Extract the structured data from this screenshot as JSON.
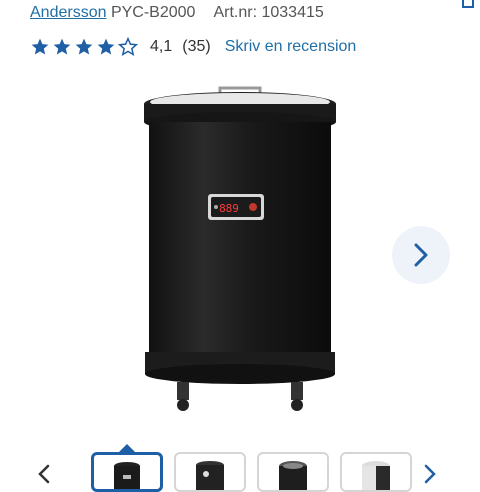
{
  "product": {
    "brand": "Andersson",
    "model": "PYC-B2000",
    "article_label": "Art.nr:",
    "article_number": "1033415"
  },
  "rating": {
    "value": 4.1,
    "display": "4,1",
    "count": "(35)",
    "stars_filled": 4,
    "stars_total": 5,
    "review_link": "Skriv en recension"
  },
  "display_readout": "889",
  "icons": [
    "share-icon",
    "star-icon",
    "chevron-right-icon",
    "chevron-left-icon"
  ],
  "colors": {
    "link": "#1f6fa5",
    "star": "#1f5fa5",
    "active_thumb": "#1f5fa5"
  },
  "gallery": {
    "thumbnail_count": 5,
    "active_index": 0
  }
}
